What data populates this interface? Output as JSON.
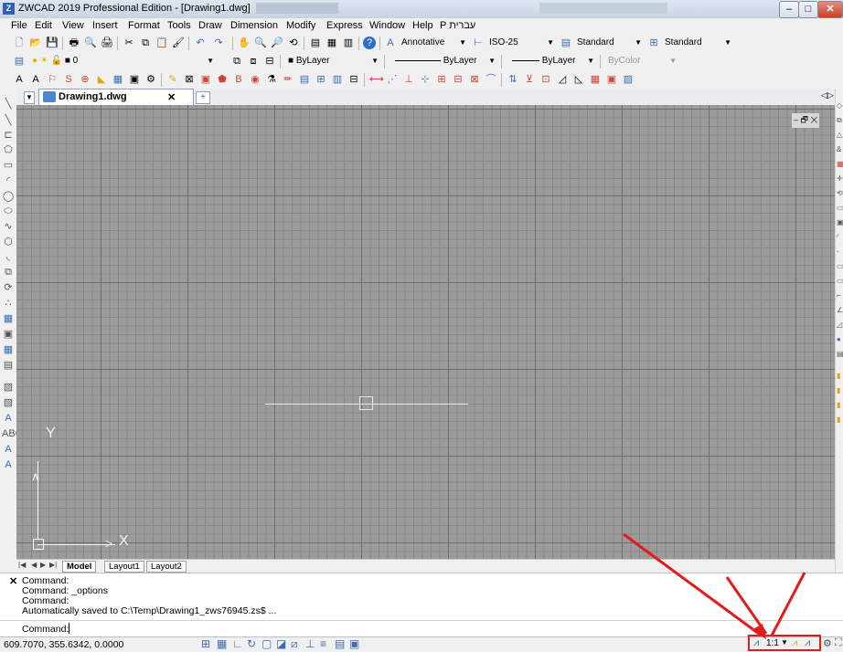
{
  "window": {
    "app_icon": "Z",
    "title": "ZWCAD 2019 Professional Edition - [Drawing1.dwg]",
    "minimize": "–",
    "maximize": "□",
    "close": "✕"
  },
  "menu": [
    "File",
    "Edit",
    "View",
    "Insert",
    "Format",
    "Tools",
    "Draw",
    "Dimension",
    "Modify",
    "Express",
    "Window",
    "Help",
    "P עברית"
  ],
  "toolbar": {
    "annotative": "Annotative",
    "dimstyle": "ISO-25",
    "textstyle": "Standard",
    "tablestyle": "Standard",
    "layer": "0",
    "color": "ByLayer",
    "linetype": "ByLayer",
    "lineweight": "ByLayer",
    "plotstyle": "ByColor"
  },
  "doc_tab": {
    "label": "Drawing1.dwg",
    "close": "✕",
    "new": "+"
  },
  "viewport_controls": {
    "minimize": "–",
    "restore": "🗗",
    "close": "✕"
  },
  "axis": {
    "y_label": "Y",
    "x_label": "X"
  },
  "layout_tabs": [
    "Model",
    "Layout1",
    "Layout2"
  ],
  "layout_nav": [
    "|◀",
    "◀",
    "▶",
    "▶|"
  ],
  "command": {
    "history": [
      "Command:",
      "Command: _options",
      "Command:",
      "Automatically saved to C:\\Temp\\Drawing1_zws76945.zs$ ..."
    ],
    "prompt": "Command:",
    "close": "✕"
  },
  "status": {
    "coordinates": "609.7070, 355.6342, 0.0000",
    "annotation_scale": "1:1"
  },
  "colors": {
    "drawing_bg": "#9b9b9b",
    "grid_major": "#6e6e6e",
    "grid_minor": "#878787",
    "annotation_red": "#e31b1b"
  }
}
